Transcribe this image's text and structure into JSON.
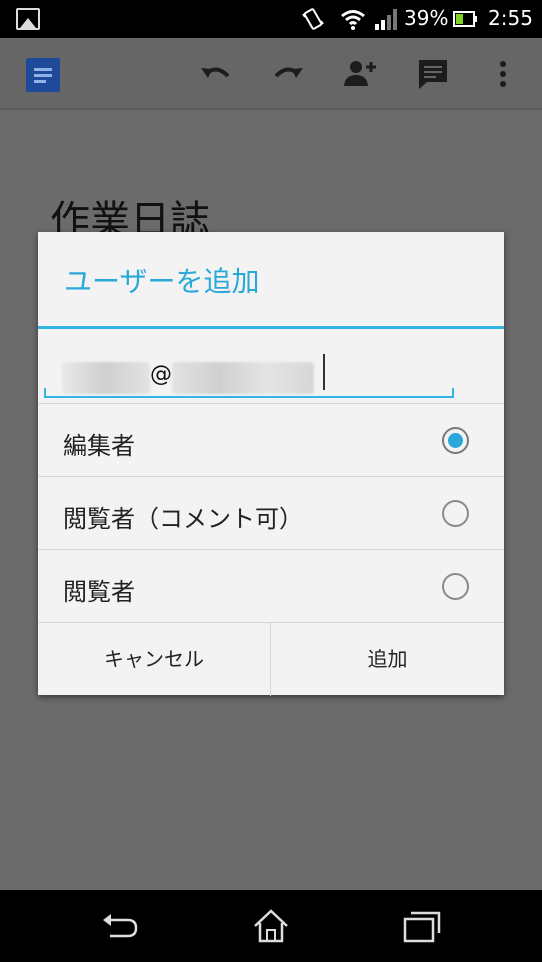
{
  "status_bar": {
    "battery_percent": "39%",
    "time": "2:55",
    "icons": [
      "gallery-icon",
      "vibrate-icon",
      "wifi-icon",
      "signal-icon",
      "battery-icon"
    ]
  },
  "toolbar": {
    "icons": [
      "docs-logo-icon",
      "undo-icon",
      "redo-icon",
      "add-person-icon",
      "comment-icon",
      "overflow-menu-icon"
    ]
  },
  "document": {
    "title": "作業日誌"
  },
  "dialog": {
    "title": "ユーザーを追加",
    "email_at_sign": "@",
    "options": [
      {
        "label": "編集者",
        "selected": true
      },
      {
        "label": "閲覧者（コメント可）",
        "selected": false
      },
      {
        "label": "閲覧者",
        "selected": false
      }
    ],
    "cancel_label": "キャンセル",
    "add_label": "追加"
  },
  "nav_bar": {
    "icons": [
      "back-icon",
      "home-icon",
      "recents-icon"
    ]
  },
  "colors": {
    "accent": "#33b5e5",
    "title_blue": "#2aa9d8",
    "dim_background": "#6b6b6b"
  }
}
